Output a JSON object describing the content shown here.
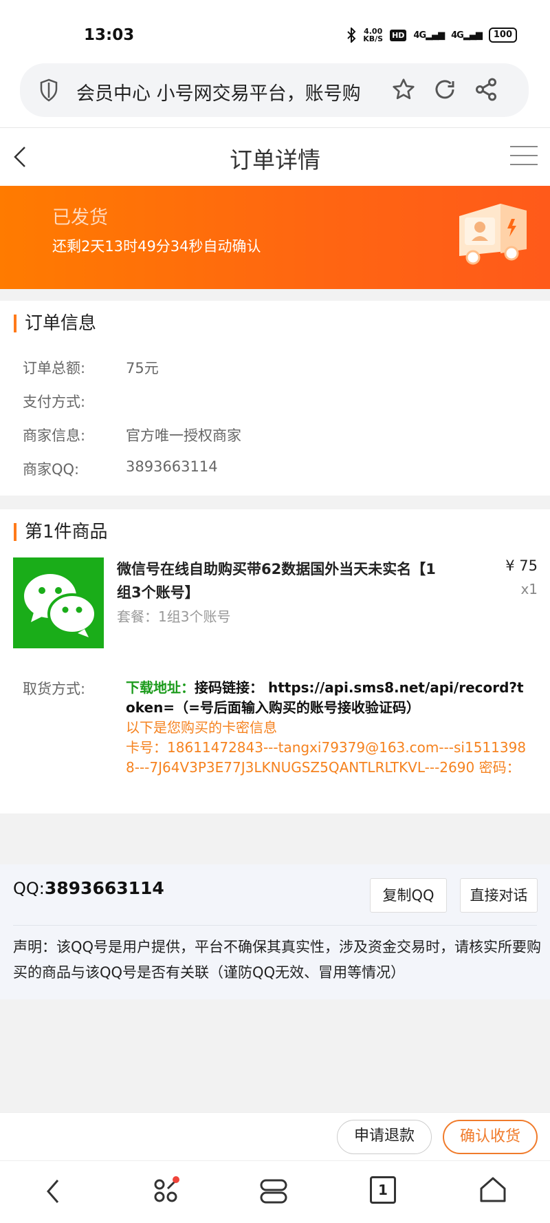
{
  "status_bar": {
    "time": "13:03",
    "net_speed_value": "4.00",
    "net_speed_unit": "KB/S",
    "hd_label": "HD",
    "signal1": "4G",
    "signal2": "4G",
    "battery": "100"
  },
  "browser": {
    "url_title": "会员中心 小号网交易平台，账号购"
  },
  "header": {
    "title": "订单详情"
  },
  "banner": {
    "status": "已发货",
    "countdown": "还剩2天13时49分34秒自动确认"
  },
  "order_info": {
    "section_title": "订单信息",
    "rows": [
      {
        "label": "订单总额:",
        "value": "75元"
      },
      {
        "label": "支付方式:",
        "value": ""
      },
      {
        "label": "商家信息:",
        "value": "官方唯一授权商家"
      },
      {
        "label": "商家QQ:",
        "value": "3893663114"
      }
    ]
  },
  "product": {
    "section_title": "第1件商品",
    "name": "微信号在线自助购买带62数据国外当天未实名【1组3个账号】",
    "price": "¥ 75",
    "qty": "x1",
    "package": "套餐：1组3个账号",
    "pickup_label": "取货方式:",
    "pickup_green": "下载地址：",
    "pickup_link": "接码链接：  https://api.sms8.net/api/record?token=（=号后面输入购买的账号接收验证码）",
    "pickup_info_title": "以下是您购买的卡密信息",
    "pickup_card": "卡号：18611472843---tangxi79379@163.com---si15113988---7J64V3P3E77J3LKNUGSZ5QANTLRLTKVL---2690 密码："
  },
  "qq_box": {
    "qq_prefix": "QQ:",
    "qq_number": "3893663114",
    "copy_btn": "复制QQ",
    "chat_btn": "直接对话",
    "notice": "声明：该QQ号是用户提供，平台不确保其真实性，涉及资金交易时，请核实所要购买的商品与该QQ号是否有关联（谨防QQ无效、冒用等情况）"
  },
  "actions": {
    "refund": "申请退款",
    "confirm": "确认收货"
  },
  "bottom_nav": {
    "tabs_count": "1"
  },
  "colors": {
    "accent": "#ff7a1a",
    "banner_start": "#ff7b00",
    "banner_end": "#ff5a1a",
    "wechat_green": "#1aad19"
  }
}
